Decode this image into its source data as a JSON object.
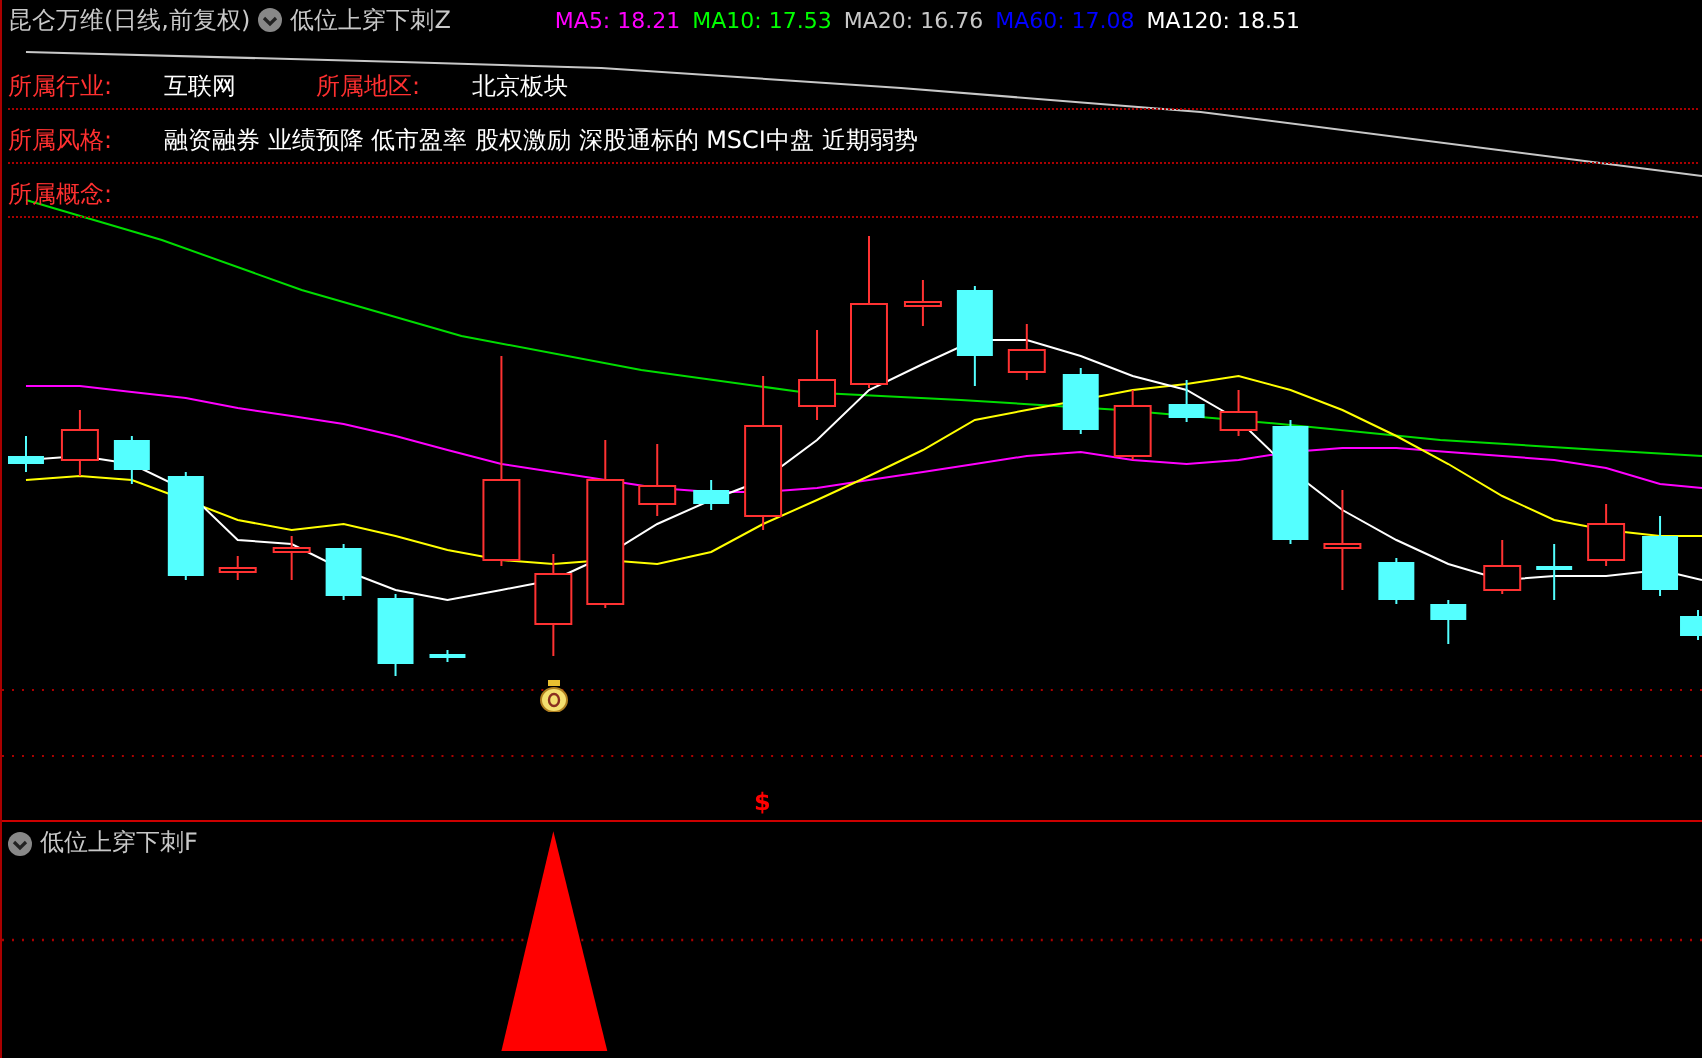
{
  "header": {
    "title": "昆仑万维(日线,前复权)",
    "indicator": "低位上穿下刺Z",
    "ma": [
      {
        "label": "MA5: 18.21",
        "color": "#ff00ff"
      },
      {
        "label": "MA10: 17.53",
        "color": "#00ff00"
      },
      {
        "label": "MA20: 16.76",
        "color": "#c8c8c8"
      },
      {
        "label": "MA60: 17.08",
        "color": "#0000ff"
      },
      {
        "label": "MA120: 18.51",
        "color": "#ffffff"
      }
    ]
  },
  "info": [
    {
      "items": [
        {
          "label": "所属行业:",
          "value": "互联网"
        },
        {
          "label": "所属地区:",
          "value": "北京板块"
        }
      ]
    },
    {
      "items": [
        {
          "label": "所属风格:",
          "value": "融资融券 业绩预降 低市盈率 股权激励 深股通标的 MSCI中盘 近期弱势"
        }
      ]
    },
    {
      "items": [
        {
          "label": "所属概念:"
        }
      ]
    }
  ],
  "sell_mark": "$",
  "subpanel": {
    "title": "低位上穿下刺F"
  }
}
